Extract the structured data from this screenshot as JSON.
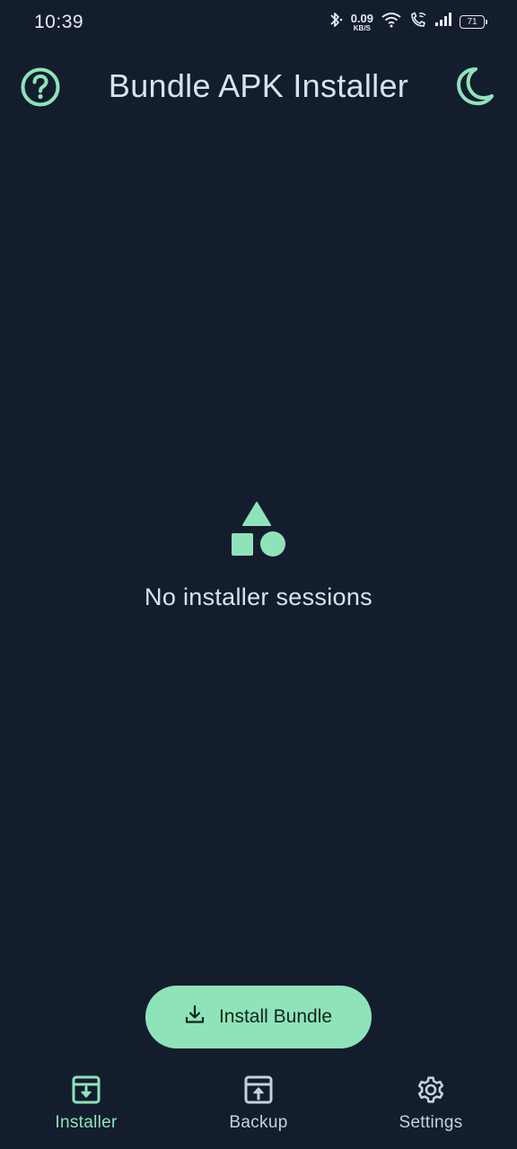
{
  "status_bar": {
    "time": "10:39",
    "net_speed_value": "0.09",
    "net_speed_unit": "KB/S",
    "battery_level": "71",
    "icons": [
      "bluetooth-icon",
      "wifi-icon",
      "wifi-call-icon",
      "signal-icon",
      "battery-icon"
    ]
  },
  "app_bar": {
    "title": "Bundle APK Installer",
    "help_icon": "help-circle-icon",
    "theme_icon": "moon-icon"
  },
  "empty_state": {
    "icon": "shapes-icon",
    "message": "No installer sessions"
  },
  "fab": {
    "label": "Install Bundle",
    "icon": "download-icon"
  },
  "bottom_nav": {
    "items": [
      {
        "label": "Installer",
        "icon": "archive-download-icon",
        "active": true
      },
      {
        "label": "Backup",
        "icon": "archive-upload-icon",
        "active": false
      },
      {
        "label": "Settings",
        "icon": "gear-icon",
        "active": false
      }
    ]
  },
  "colors": {
    "background": "#141d2e",
    "accent": "#8fe3b9",
    "text": "#d9e3f0",
    "fab_text": "#10261c"
  }
}
